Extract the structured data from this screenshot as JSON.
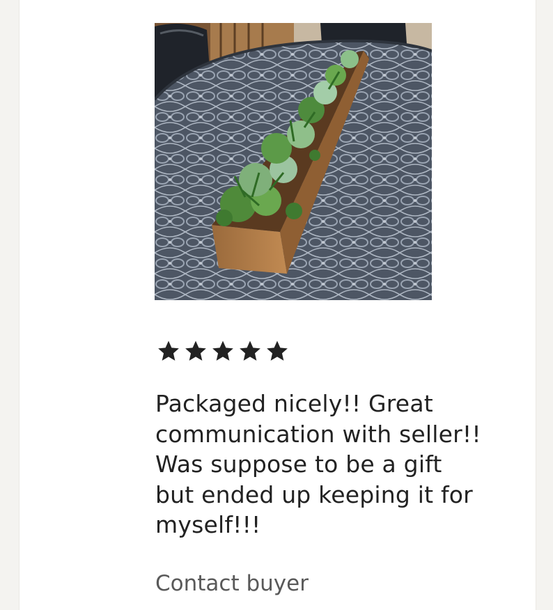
{
  "review": {
    "image_alt": "Wooden planter box with succulents on patio table",
    "rating": 5,
    "rating_max": 5,
    "star_color": "#222222",
    "text": "Packaged nicely!! Great communication with seller!! Was suppose to be a gift but ended up keeping it for myself!!!",
    "lines": [
      "Packaged nicely!! Great",
      "communication with seller!!",
      "Was suppose to be a gift",
      "but ended up keeping it for",
      "myself!!!"
    ]
  },
  "actions": {
    "contact_label": "Contact buyer"
  }
}
